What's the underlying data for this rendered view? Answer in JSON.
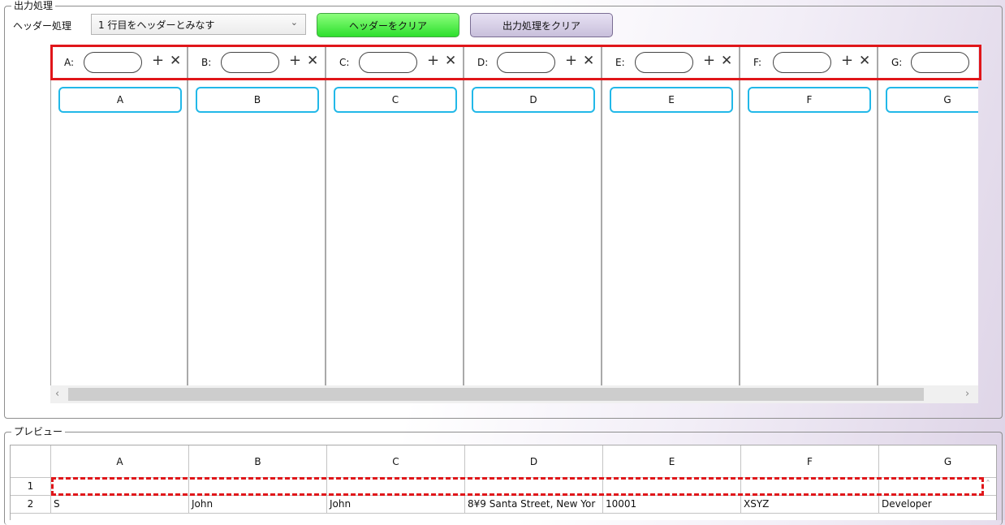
{
  "output_section": {
    "title": "出力処理",
    "header_mode_label": "ヘッダー処理",
    "header_mode_value": "1 行目をヘッダーとみなす",
    "clear_header_button": "ヘッダーをクリア",
    "clear_output_button": "出力処理をクリア",
    "columns": [
      {
        "key": "A:",
        "chip": "A"
      },
      {
        "key": "B:",
        "chip": "B"
      },
      {
        "key": "C:",
        "chip": "C"
      },
      {
        "key": "D:",
        "chip": "D"
      },
      {
        "key": "E:",
        "chip": "E"
      },
      {
        "key": "F:",
        "chip": "F"
      },
      {
        "key": "G:",
        "chip": "G"
      }
    ],
    "icons": {
      "add": "plus-icon",
      "remove": "close-icon",
      "dropdown": "chevron-down-icon"
    }
  },
  "preview_section": {
    "title": "プレビュー",
    "headers": [
      "A",
      "B",
      "C",
      "D",
      "E",
      "F",
      "G"
    ],
    "rows": [
      {
        "num": "1",
        "cells": [
          "",
          "",
          "",
          "",
          "",
          "",
          ""
        ]
      },
      {
        "num": "2",
        "cells": [
          "S",
          "John",
          "John",
          "8¥9 Santa Street, New Yor",
          "10001",
          "XSYZ",
          "Developer"
        ]
      }
    ]
  },
  "colors": {
    "highlight": "#e0161a",
    "chip_border": "#22b8e8",
    "green_button": "#2ddf2d",
    "purple_button": "#c8bfdb"
  }
}
